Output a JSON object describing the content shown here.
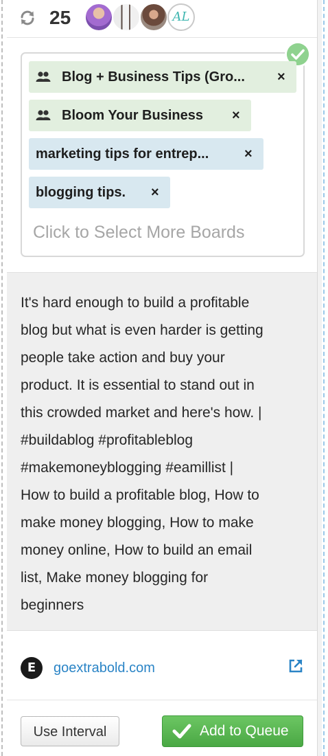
{
  "header": {
    "refresh_icon": "refresh-icon",
    "count": "25",
    "avatars": [
      {
        "name": "avatar-1"
      },
      {
        "name": "avatar-2"
      },
      {
        "name": "avatar-3"
      },
      {
        "name": "avatar-4",
        "initials": "AL"
      }
    ]
  },
  "boards": {
    "status_icon": "check-circle-icon",
    "chips": [
      {
        "type": "group",
        "label": "Blog + Business Tips (Gro...",
        "remove": "×"
      },
      {
        "type": "group",
        "label": "Bloom Your Business",
        "remove": "×"
      },
      {
        "type": "board",
        "label": "marketing tips for entrep...",
        "remove": "×"
      },
      {
        "type": "board",
        "label": "blogging tips.",
        "remove": "×"
      }
    ],
    "placeholder": "Click to Select More Boards"
  },
  "description": {
    "lines": [
      "It's hard enough to build a profitable",
      "blog but what is even harder is getting",
      "people take action and buy your",
      "product. It is essential to stand out in",
      "this crowded market and here's how. |",
      "#buildablog #profitableblog",
      "#makemoneyblogging #eamillist |",
      "How to build a profitable blog, How to",
      "make money blogging, How to make",
      "money online, How to build an email",
      "list, Make money blogging for",
      "beginners"
    ]
  },
  "source": {
    "logo_letter": "E",
    "domain": "goextrabold.com",
    "external_icon": "external-link-icon"
  },
  "actions": {
    "interval_label": "Use Interval",
    "queue_label": "Add to Queue"
  },
  "colors": {
    "group_chip_bg": "#e2efdf",
    "board_chip_bg": "#d8e8f0",
    "link": "#2a84c6",
    "queue_button": "#5cb85c",
    "check_badge": "#8fd28f"
  }
}
